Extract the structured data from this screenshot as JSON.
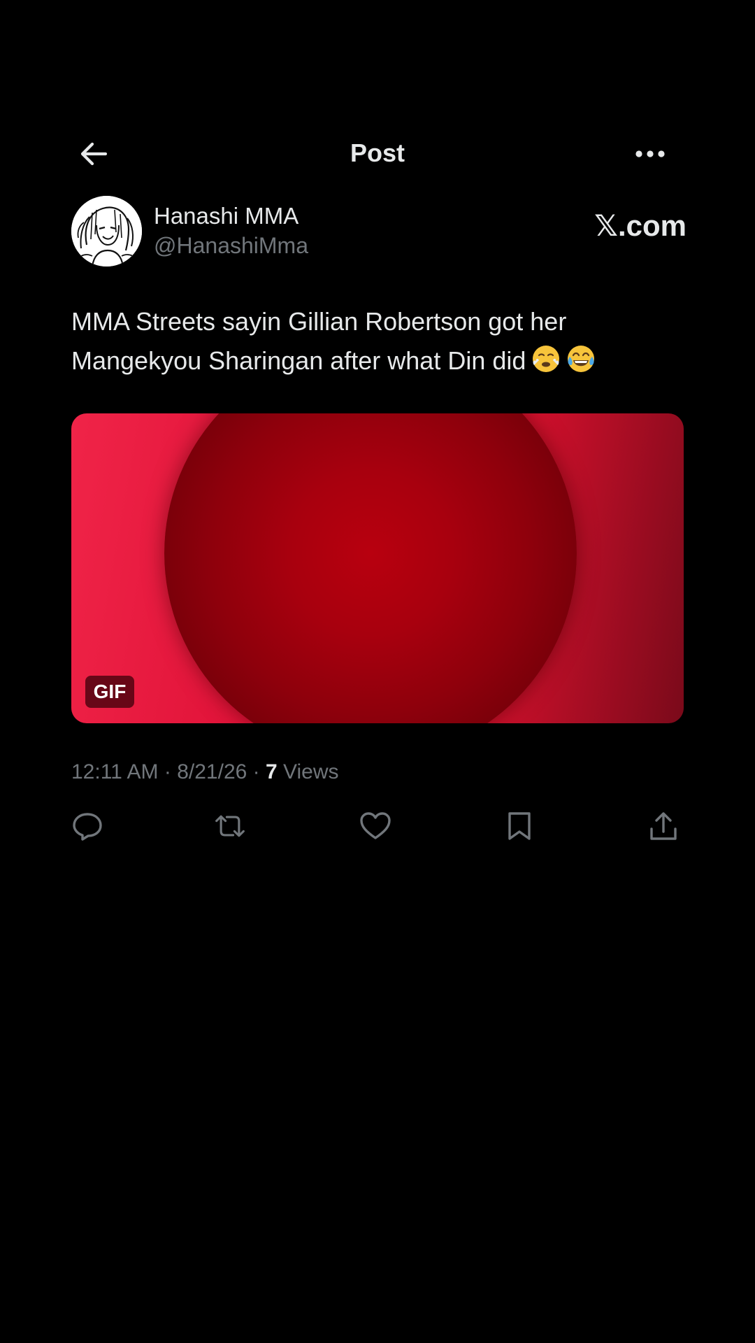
{
  "header": {
    "title": "Post",
    "back_icon": "arrow-left-icon",
    "more_icon": "more-horizontal-icon"
  },
  "author": {
    "display_name": "Hanashi MMA",
    "handle": "@HanashiMma",
    "avatar_icon": "sketch-avatar"
  },
  "watermark": "𝕏.com",
  "post": {
    "text": "MMA Streets sayin Gillian Robertson got her Mangekyou Sharingan after what Din did",
    "emojis": [
      "face-with-steam-icon",
      "tears-of-joy-icon"
    ]
  },
  "media": {
    "badge": "GIF",
    "colors": {
      "bright": "#f02448",
      "dark": "#8e000c"
    }
  },
  "meta": {
    "time": "12:11 AM",
    "separator": "·",
    "date": "8/21/26",
    "views_count": "7",
    "views_label": "Views"
  },
  "actions": [
    {
      "name": "reply",
      "icon": "reply-icon"
    },
    {
      "name": "repost",
      "icon": "repost-icon"
    },
    {
      "name": "like",
      "icon": "heart-icon"
    },
    {
      "name": "bookmark",
      "icon": "bookmark-icon"
    },
    {
      "name": "share",
      "icon": "share-icon"
    }
  ],
  "colors": {
    "background": "#000000",
    "text_primary": "#e7e9ea",
    "text_secondary": "#71767b"
  }
}
